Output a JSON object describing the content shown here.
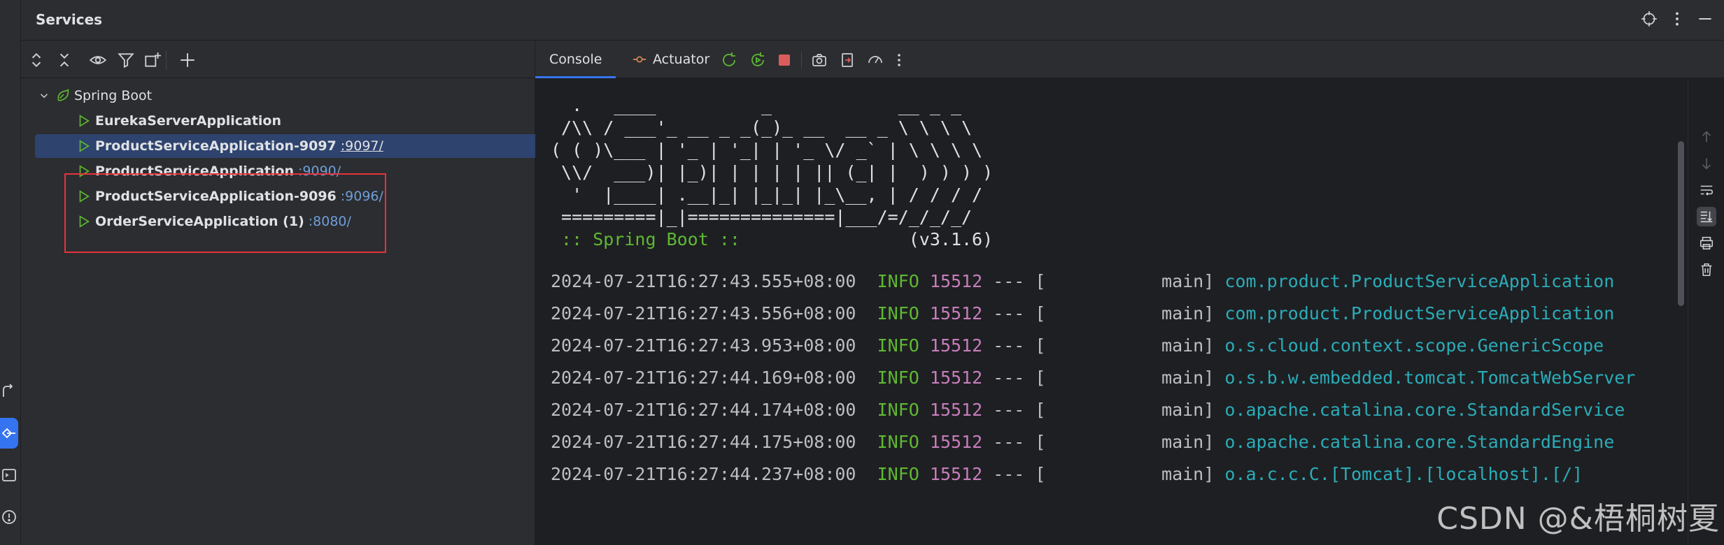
{
  "header": {
    "title": "Services"
  },
  "tree": {
    "root": {
      "label": "Spring Boot"
    },
    "items": [
      {
        "name": "EurekaServerApplication",
        "port": ""
      },
      {
        "name": "ProductServiceApplication-9097",
        "port": ":9097/"
      },
      {
        "name": "ProductServiceApplication",
        "port": ":9090/"
      },
      {
        "name": "ProductServiceApplication-9096",
        "port": ":9096/"
      },
      {
        "name": "OrderServiceApplication (1)",
        "port": ":8080/"
      }
    ]
  },
  "console": {
    "tabs": [
      {
        "label": "Console"
      },
      {
        "label": "Actuator"
      }
    ],
    "banner": [
      "  .   ____          _            __ _ _",
      " /\\\\ / ___'_ __ _ _(_)_ __  __ _ \\ \\ \\ \\",
      "( ( )\\___ | '_ | '_| | '_ \\/ _` | \\ \\ \\ \\",
      " \\\\/  ___)| |_)| | | | | || (_| |  ) ) ) )",
      "  '  |____| .__|_| |_|_| |_\\__, | / / / /",
      " =========|_|==============|___/=/_/_/_/"
    ],
    "spring_boot_label": " :: Spring Boot :: ",
    "spring_boot_version": "               (v3.1.6)",
    "logs": [
      {
        "ts": "2024-07-21T16:27:43.555+08:00",
        "level": " INFO",
        "pid": "15512",
        "sep": " --- [",
        "thread": "           main]",
        "logger": "com.product.ProductServiceApplication"
      },
      {
        "ts": "2024-07-21T16:27:43.556+08:00",
        "level": " INFO",
        "pid": "15512",
        "sep": " --- [",
        "thread": "           main]",
        "logger": "com.product.ProductServiceApplication"
      },
      {
        "ts": "2024-07-21T16:27:43.953+08:00",
        "level": " INFO",
        "pid": "15512",
        "sep": " --- [",
        "thread": "           main]",
        "logger": "o.s.cloud.context.scope.GenericScope"
      },
      {
        "ts": "2024-07-21T16:27:44.169+08:00",
        "level": " INFO",
        "pid": "15512",
        "sep": " --- [",
        "thread": "           main]",
        "logger": "o.s.b.w.embedded.tomcat.TomcatWebServer"
      },
      {
        "ts": "2024-07-21T16:27:44.174+08:00",
        "level": " INFO",
        "pid": "15512",
        "sep": " --- [",
        "thread": "           main]",
        "logger": "o.apache.catalina.core.StandardService"
      },
      {
        "ts": "2024-07-21T16:27:44.175+08:00",
        "level": " INFO",
        "pid": "15512",
        "sep": " --- [",
        "thread": "           main]",
        "logger": "o.apache.catalina.core.StandardEngine"
      },
      {
        "ts": "2024-07-21T16:27:44.237+08:00",
        "level": " INFO",
        "pid": "15512",
        "sep": " --- [",
        "thread": "           main]",
        "logger": "o.a.c.c.C.[Tomcat].[localhost].[/]"
      }
    ]
  },
  "watermark": "CSDN @&梧桐树夏",
  "colors": {
    "accent": "#3574f0",
    "selection": "#2e436e",
    "highlight_box": "#e8323c",
    "run_green": "#5fb832"
  }
}
